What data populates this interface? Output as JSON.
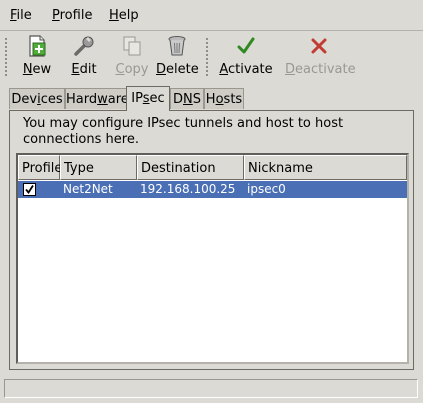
{
  "menubar": {
    "items": [
      {
        "pre": "",
        "key": "F",
        "post": "ile"
      },
      {
        "pre": "",
        "key": "P",
        "post": "rofile"
      },
      {
        "pre": "",
        "key": "H",
        "post": "elp"
      }
    ]
  },
  "toolbar": {
    "new": {
      "pre": "",
      "key": "N",
      "post": "ew",
      "icon": "new-icon"
    },
    "edit": {
      "pre": "",
      "key": "E",
      "post": "dit",
      "icon": "wrench-icon"
    },
    "copy": {
      "pre": "",
      "key": "C",
      "post": "opy",
      "icon": "copy-icon",
      "disabled": true
    },
    "delete": {
      "pre": "",
      "key": "D",
      "post": "elete",
      "icon": "trash-icon"
    },
    "activate": {
      "pre": "",
      "key": "A",
      "post": "ctivate",
      "icon": "checkmark-icon"
    },
    "deactivate": {
      "pre": "",
      "key": "D",
      "post": "eactivate",
      "icon": "x-icon",
      "disabled": true
    }
  },
  "tabs": [
    {
      "pre": "Dev",
      "key": "i",
      "post": "ces"
    },
    {
      "pre": "Hard",
      "key": "w",
      "post": "are"
    },
    {
      "pre": "IP",
      "key": "s",
      "post": "ec",
      "active": true
    },
    {
      "pre": "D",
      "key": "N",
      "post": "S"
    },
    {
      "pre": "H",
      "key": "o",
      "post": "sts"
    }
  ],
  "panel": {
    "description": "You may configure IPsec tunnels and host to host connections here."
  },
  "table": {
    "columns": [
      "Profile",
      "Type",
      "Destination",
      "Nickname"
    ],
    "rows": [
      {
        "profile_checked": true,
        "type": "Net2Net",
        "destination": "192.168.100.25",
        "nickname": "ipsec0",
        "selected": true
      }
    ]
  },
  "colors": {
    "selection": "#4a6fb5",
    "activate_green": "#2f8a22",
    "deactivate_red": "#c23b32"
  }
}
